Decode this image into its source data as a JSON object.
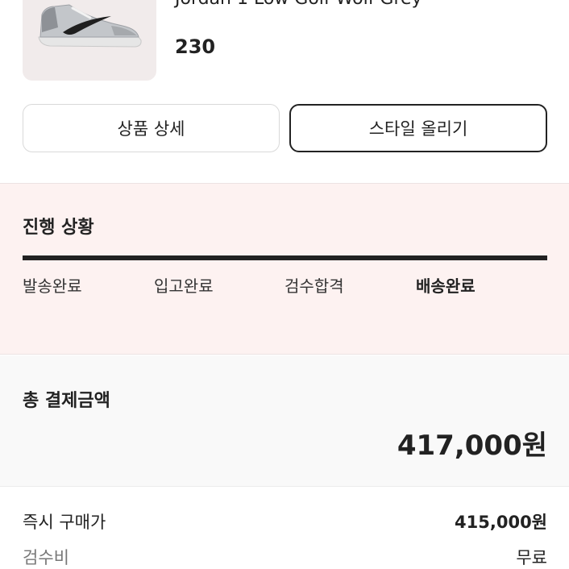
{
  "product": {
    "name": "Jordan 1 Low Golf Wolf Grey",
    "size": "230",
    "image_icon": "sneaker-image"
  },
  "actions": {
    "detail_label": "상품 상세",
    "style_label": "스타일 올리기"
  },
  "progress": {
    "title": "진행 상황",
    "steps": [
      "발송완료",
      "입고완료",
      "검수합격",
      "배송완료"
    ],
    "active_step": "배송완료",
    "completion": 1.0
  },
  "payment": {
    "total_label": "총 결제금액",
    "total_value": "417,000원",
    "items": [
      {
        "label": "즉시 구매가",
        "value": "415,000원"
      },
      {
        "label": "검수비",
        "value": "무료"
      }
    ]
  },
  "colors": {
    "progress_bg": "#fdf2f1",
    "total_bg": "#f9f9f9",
    "accent": "#222222"
  }
}
